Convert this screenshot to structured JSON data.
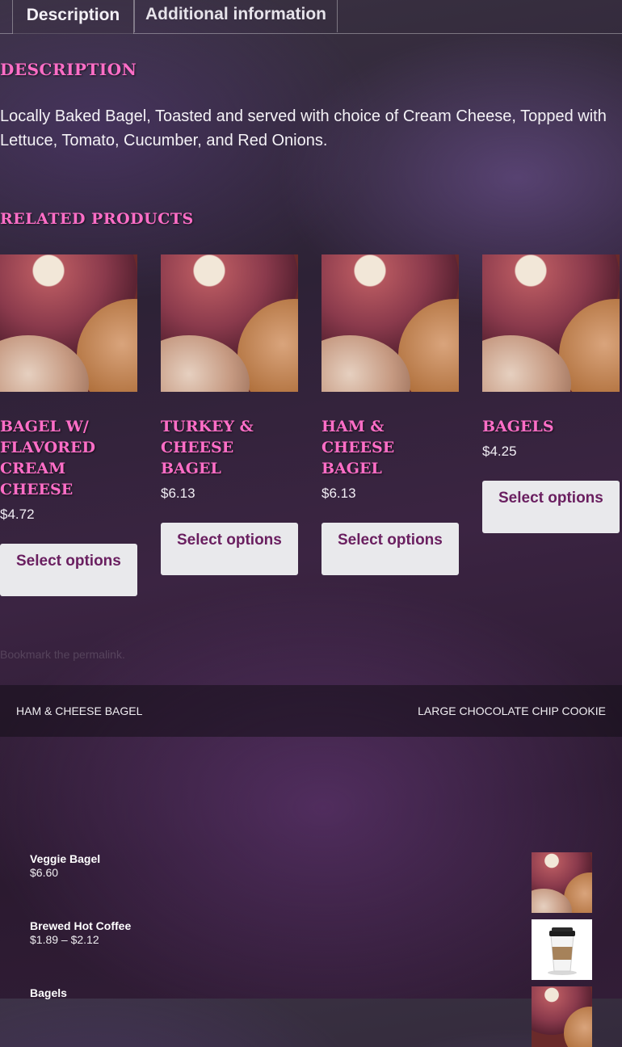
{
  "tabs": [
    {
      "label": "Description",
      "active": true
    },
    {
      "label": "Additional information",
      "active": false
    }
  ],
  "description": {
    "heading": "DESCRIPTION",
    "text": "Locally Baked Bagel, Toasted and served with choice of Cream Cheese, Topped with Lettuce, Tomato, Cucumber, and Red Onions."
  },
  "related": {
    "heading": "RELATED PRODUCTS",
    "products": [
      {
        "name": "BAGEL W/ FLAVORED CREAM CHEESE",
        "price": "$4.72",
        "button": "Select options"
      },
      {
        "name": "TURKEY & CHEESE BAGEL",
        "price": "$6.13",
        "button": "Select options"
      },
      {
        "name": "HAM & CHEESE BAGEL",
        "price": "$6.13",
        "button": "Select options"
      },
      {
        "name": "BAGELS",
        "price": "$4.25",
        "button": "Select options"
      }
    ]
  },
  "permalink": {
    "text": "Bookmark the permalink."
  },
  "post_nav": {
    "prev": "HAM & CHEESE BAGEL",
    "next": "LARGE CHOCOLATE CHIP COOKIE"
  },
  "widget": {
    "items": [
      {
        "name": "Veggie Bagel",
        "price": "$6.60",
        "thumb": "bagel"
      },
      {
        "name": "Brewed Hot Coffee",
        "price": "$1.89 – $2.12",
        "thumb": "coffee-cup"
      },
      {
        "name": "Bagels",
        "price": "",
        "thumb": "bagel"
      }
    ]
  },
  "colors": {
    "accent": "#ff6ec7",
    "button_bg": "#e9e9ec",
    "button_text": "#6a1f60"
  }
}
